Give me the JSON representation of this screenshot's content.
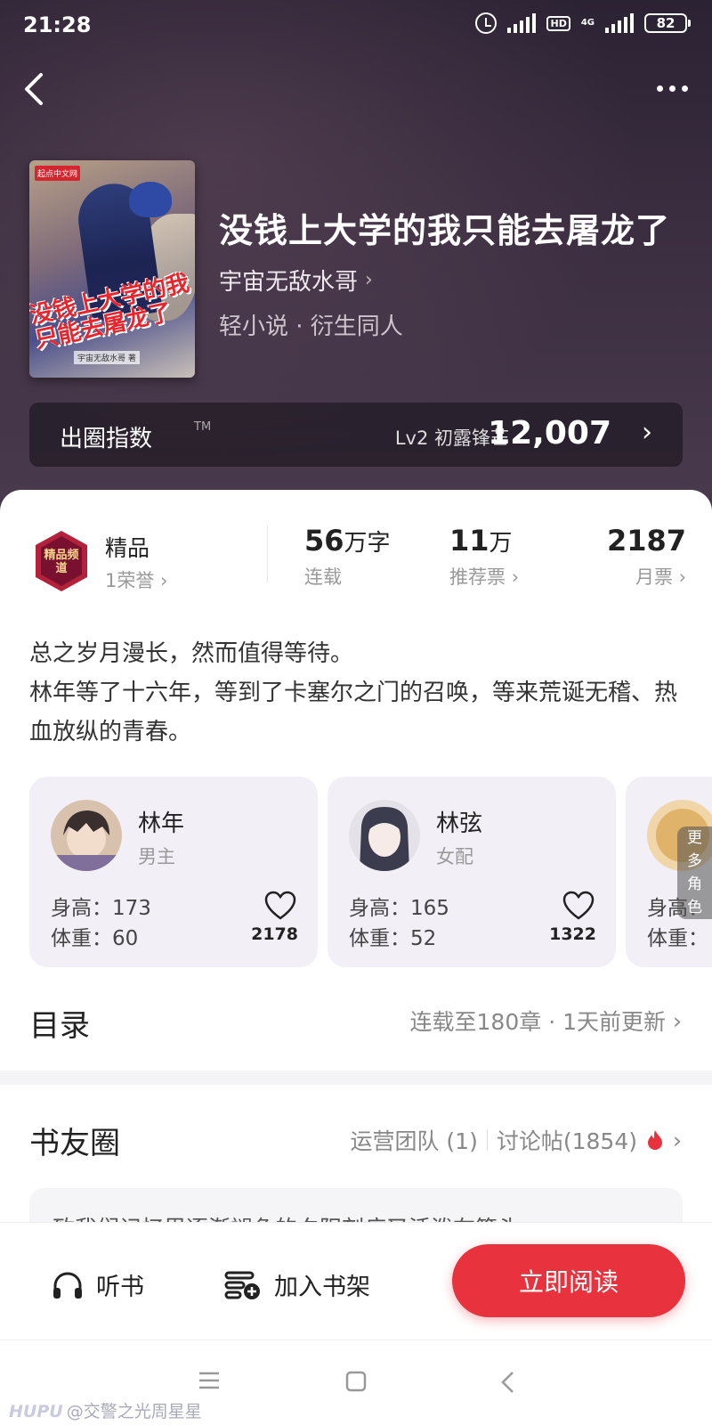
{
  "status_bar": {
    "time": "21:28",
    "network": "4G",
    "hd": "HD",
    "battery": "82"
  },
  "book": {
    "title": "没钱上大学的我只能去屠龙了",
    "author": "宇宙无敌水哥",
    "category": "轻小说 · 衍生同人",
    "cover": {
      "publisher_badge": "起点中文网",
      "title_art": "没钱上大学的我只能去屠龙了",
      "author_art": "宇宙无敌水哥 著"
    }
  },
  "index": {
    "label": "出圈指数",
    "tm": "TM",
    "level": "Lv2 初露锋芒",
    "value": "12,007"
  },
  "honor": {
    "badge_text": "精品频道",
    "title": "精品",
    "sub": "1荣誉"
  },
  "stats": {
    "words": {
      "num": "56",
      "unit": "万字",
      "label": "连载"
    },
    "recommend": {
      "num": "11",
      "unit": "万",
      "label": "推荐票"
    },
    "monthly": {
      "num": "2187",
      "label": "月票"
    }
  },
  "description": [
    "总之岁月漫长，然而值得等待。",
    "林年等了十六年，等到了卡塞尔之门的召唤，等来荒诞无稽、热血放纵的青春。"
  ],
  "roles": [
    {
      "name": "林年",
      "role": "男主",
      "height": "身高：173",
      "weight": "体重：60",
      "likes": "2178"
    },
    {
      "name": "林弦",
      "role": "女配",
      "height": "身高：165",
      "weight": "体重：52",
      "likes": "1322"
    },
    {
      "name": "",
      "role": "",
      "height": "身高：",
      "weight": "体重：",
      "likes": ""
    }
  ],
  "more_roles": "更多角色",
  "toc": {
    "title": "目录",
    "info": "连载至180章 · 1天前更新"
  },
  "circle": {
    "title": "书友圈",
    "team": "运营团队 (1)",
    "posts": "讨论帖(1854)"
  },
  "post_preview": "致我们记忆里逐渐褪色的夕阳刻痕又活泼在篇头",
  "actions": {
    "listen": "听书",
    "add_shelf": "加入书架",
    "read": "立即阅读"
  },
  "watermark": {
    "brand": "HUPU",
    "user": "@交警之光周星星"
  },
  "colors": {
    "accent": "#e8323d",
    "hero_bg": "#3b2e40"
  }
}
